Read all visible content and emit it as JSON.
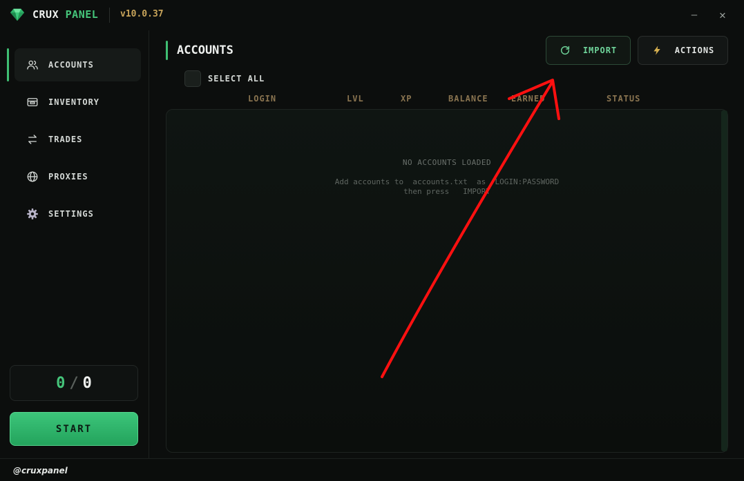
{
  "app": {
    "brand_part1": "CRUX",
    "brand_part2": "PANEL",
    "version": "v10.0.37",
    "accent_color": "#3fbf73",
    "gold_color": "#c8a45a"
  },
  "window": {
    "minimize_icon": "minimize-icon",
    "close_icon": "close-icon"
  },
  "sidebar": {
    "items": [
      {
        "label": "ACCOUNTS",
        "icon": "users-icon",
        "active": true
      },
      {
        "label": "INVENTORY",
        "icon": "wallet-icon",
        "active": false
      },
      {
        "label": "TRADES",
        "icon": "swap-icon",
        "active": false
      },
      {
        "label": "PROXIES",
        "icon": "globe-icon",
        "active": false
      },
      {
        "label": "SETTINGS",
        "icon": "gear-icon",
        "active": false
      }
    ],
    "counter": {
      "done": "0",
      "separator": "/",
      "total": "0"
    },
    "start_label": "START"
  },
  "main": {
    "title": "ACCOUNTS",
    "import_label": "IMPORT",
    "actions_label": "ACTIONS",
    "select_all_label": "SELECT ALL",
    "columns": [
      "LOGIN",
      "LVL",
      "XP",
      "BALANCE",
      "EARNED",
      "STATUS"
    ],
    "empty": {
      "title": "NO ACCOUNTS LOADED",
      "line1": "Add accounts to  accounts.txt  as  LOGIN:PASSWORD",
      "line2": "then press   IMPORT"
    }
  },
  "footer": {
    "handle": "@cruxpanel"
  }
}
